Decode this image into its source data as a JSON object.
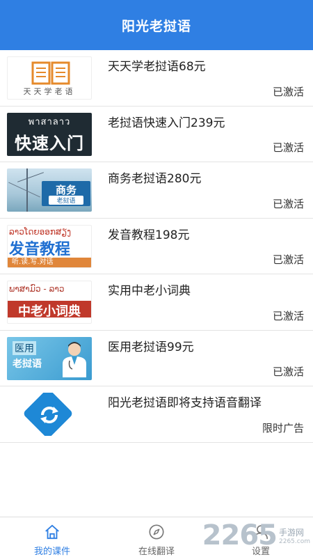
{
  "header": {
    "title": "阳光老挝语"
  },
  "courses": [
    {
      "title": "天天学老挝语68元",
      "status": "已激活",
      "thumb_caption": "天天学老语"
    },
    {
      "title": "老挝语快速入门239元",
      "status": "已激活",
      "thumb_top": "พาสาลาว",
      "thumb_text": "快速入门"
    },
    {
      "title": "商务老挝语280元",
      "status": "已激活",
      "thumb_text": "商务",
      "thumb_sub": "老挝语"
    },
    {
      "title": "发音教程198元",
      "status": "已激活",
      "thumb_top": "ລາວໂດຍອອກສຽງ",
      "thumb_text": "发音教程",
      "thumb_sub": "听.读.写.对话"
    },
    {
      "title": "实用中老小词典",
      "status": "已激活",
      "thumb_top": "ພາສາມົວ - ລາວ",
      "thumb_text": "中老小词典"
    },
    {
      "title": "医用老挝语99元",
      "status": "已激活",
      "thumb_l1": "医用",
      "thumb_l2": "老挝语"
    },
    {
      "title": "阳光老挝语即将支持语音翻译",
      "status": "限时广告"
    }
  ],
  "bottom_nav": {
    "items": [
      {
        "label": "我的课件",
        "icon": "home-icon",
        "active": true
      },
      {
        "label": "在线翻译",
        "icon": "compass-icon",
        "active": false
      },
      {
        "label": "设置",
        "icon": "user-icon",
        "active": false
      }
    ]
  },
  "watermark": {
    "number": "2265",
    "cn": "手游网",
    "en": "2265.com"
  },
  "colors": {
    "primary": "#2f7fe3",
    "divider": "#e3e3e3"
  }
}
